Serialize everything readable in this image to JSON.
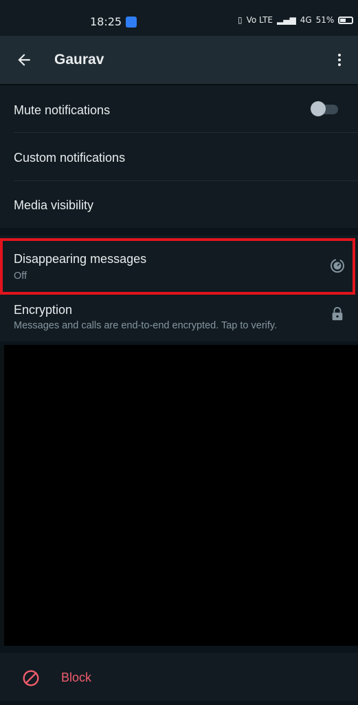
{
  "status_bar": {
    "time": "18:25",
    "indicators": "Vo LTE",
    "network": "4G",
    "battery": "51%"
  },
  "header": {
    "title": "Gaurav",
    "back_icon": "arrow-left",
    "menu_icon": "more-vertical"
  },
  "notifications": {
    "mute_label": "Mute notifications",
    "mute_on": false,
    "custom_label": "Custom notifications",
    "media_label": "Media visibility"
  },
  "privacy": {
    "disappearing_label": "Disappearing messages",
    "disappearing_value": "Off",
    "encryption_label": "Encryption",
    "encryption_sub": "Messages and calls are end-to-end encrypted. Tap to verify."
  },
  "block": {
    "label": "Block"
  },
  "colors": {
    "background": "#0b141a",
    "panel": "#111b21",
    "header": "#202c33",
    "highlight": "#e1141d",
    "danger": "#f15c6d",
    "text": "#e9edef",
    "subtext": "#8696a0"
  }
}
